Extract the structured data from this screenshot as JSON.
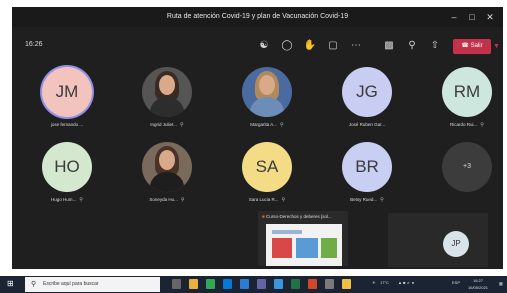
{
  "window": {
    "title": "Ruta de atención Covid-19 y plan de Vacunación Covid-19"
  },
  "toolbar": {
    "time": "16:26",
    "leave_label": "Salir"
  },
  "participants": [
    {
      "initials": "JM",
      "name": "jose fernando ...",
      "avatar_color": "#f2c4bd",
      "muted": false,
      "highlighted": true
    },
    {
      "initials": "",
      "name": "Ingrid Juliet...",
      "photo": true,
      "muted": true
    },
    {
      "initials": "",
      "name": "Margarita A...",
      "photo": true,
      "muted": true
    },
    {
      "initials": "JG",
      "name": "José Ruben Gar...",
      "avatar_color": "#c9cdf1",
      "muted": false
    },
    {
      "initials": "RM",
      "name": "Ricardo Rui...",
      "avatar_color": "#cde6de",
      "muted": true
    },
    {
      "initials": "HO",
      "name": "Hugo Hum...",
      "avatar_color": "#d4e8cf",
      "muted": true
    },
    {
      "initials": "",
      "name": "Soneyda Hu...",
      "photo": true,
      "muted": true
    },
    {
      "initials": "SA",
      "name": "Sara Lucia R...",
      "avatar_color": "#f4dc87",
      "muted": true
    },
    {
      "initials": "BR",
      "name": "Betsy Rued...",
      "avatar_color": "#c8cff3",
      "muted": true
    },
    {
      "initials": "+3",
      "name": "",
      "avatar_color": "#3c3c3c",
      "overflow": true
    }
  ],
  "share": {
    "title": "Curso-Derechos y deberes [sol..."
  },
  "self": {
    "initials": "JP"
  },
  "taskbar": {
    "search_placeholder": "Escribe aquí para buscar",
    "temperature": "17°C",
    "language": "ESP",
    "time": "16:27",
    "date": "16/05/2021"
  }
}
